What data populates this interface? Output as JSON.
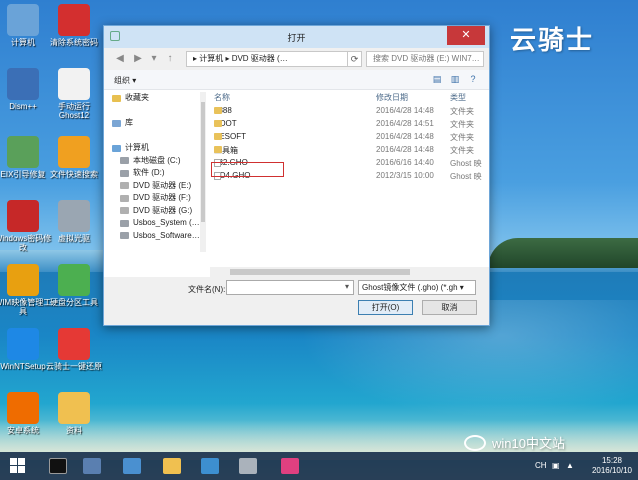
{
  "brand": "云骑士",
  "desktop": {
    "icons": [
      {
        "label": "计算机",
        "icon": "computer-icon",
        "color": "#6aa3d8"
      },
      {
        "label": "清除系统密码",
        "icon": "password-reset-icon",
        "color": "#d32f2f"
      },
      {
        "label": "Dism++",
        "icon": "dism-icon",
        "color": "#3b6fb6"
      },
      {
        "label": "手动运行Ghost12",
        "icon": "ghost-icon",
        "color": "#f2f2f2"
      },
      {
        "label": "EIX引导修复",
        "icon": "boot-repair-icon",
        "color": "#5aa05a"
      },
      {
        "label": "文件快速搜索",
        "icon": "file-search-icon",
        "color": "#f0a020"
      },
      {
        "label": "Windows密码修改",
        "icon": "windows-password-icon",
        "color": "#c62828"
      },
      {
        "label": "虚拟光驱",
        "icon": "virtual-drive-icon",
        "color": "#9aa6b2"
      },
      {
        "label": "WIM映像管理工具",
        "icon": "wim-icon",
        "color": "#e8a010"
      },
      {
        "label": "硬盘分区工具",
        "icon": "partition-icon",
        "color": "#4caf50"
      },
      {
        "label": "WinNTSetup",
        "icon": "winntsetup-icon",
        "color": "#1e88e5"
      },
      {
        "label": "云骑士一键还原",
        "icon": "restore-icon",
        "color": "#e53935"
      },
      {
        "label": "安卓系统",
        "icon": "android-tool-icon",
        "color": "#ef6c00"
      },
      {
        "label": "资料",
        "icon": "folder-icon",
        "color": "#f0c050"
      }
    ]
  },
  "dialog": {
    "title": "打开",
    "close_label": "✕",
    "address": "▸ 计算机 ▸ DVD 驱动器 (…",
    "search_placeholder": "搜索 DVD 驱动器 (E:) WIN7…",
    "organize": "组织 ▾",
    "nav": [
      {
        "label": "收藏夹",
        "color": "#e8c050"
      },
      {
        "label": "",
        "color": ""
      },
      {
        "label": "库",
        "color": "#7ba6d4"
      },
      {
        "label": "",
        "color": ""
      },
      {
        "label": "计算机",
        "color": "#6aa3d8"
      },
      {
        "label": "本地磁盘 (C:)",
        "color": "#9aa0a8"
      },
      {
        "label": "软件 (D:)",
        "color": "#9aa0a8"
      },
      {
        "label": "DVD 驱动器 (E:)",
        "color": "#b0b0b0"
      },
      {
        "label": "DVD 驱动器 (F:)",
        "color": "#b0b0b0"
      },
      {
        "label": "DVD 驱动器 (G:)",
        "color": "#b0b0b0"
      },
      {
        "label": "Usbos_System (…",
        "color": "#9aa0a8"
      },
      {
        "label": "Usbos_Software…",
        "color": "#9aa0a8"
      }
    ],
    "columns": {
      "name": "名称",
      "date": "修改日期",
      "type": "类型"
    },
    "files": [
      {
        "name": "8888",
        "date": "2016/4/28 14:48",
        "type": "文件夹",
        "kind": "folder"
      },
      {
        "name": "BOOT",
        "date": "2016/4/28 14:51",
        "type": "文件夹",
        "kind": "folder"
      },
      {
        "name": "PESOFT",
        "date": "2016/4/28 14:48",
        "type": "文件夹",
        "kind": "folder"
      },
      {
        "name": "工具箱",
        "date": "2016/4/28 14:48",
        "type": "文件夹",
        "kind": "folder"
      },
      {
        "name": "732.GHO",
        "date": "2016/6/16 14:40",
        "type": "Ghost 映",
        "kind": "file"
      },
      {
        "name": "HD4.GHO",
        "date": "2012/3/15 10:00",
        "type": "Ghost 映",
        "kind": "file"
      }
    ],
    "filename_label": "文件名(N):",
    "filename_value": "",
    "filter": "Ghost镜像文件 (.gho) (*.gh ▾",
    "open_button": "打开(O)",
    "cancel_button": "取消"
  },
  "watermark": "win10中文站",
  "taskbar": {
    "lang": "CH",
    "time": "15:28",
    "date": "2016/10/10"
  }
}
